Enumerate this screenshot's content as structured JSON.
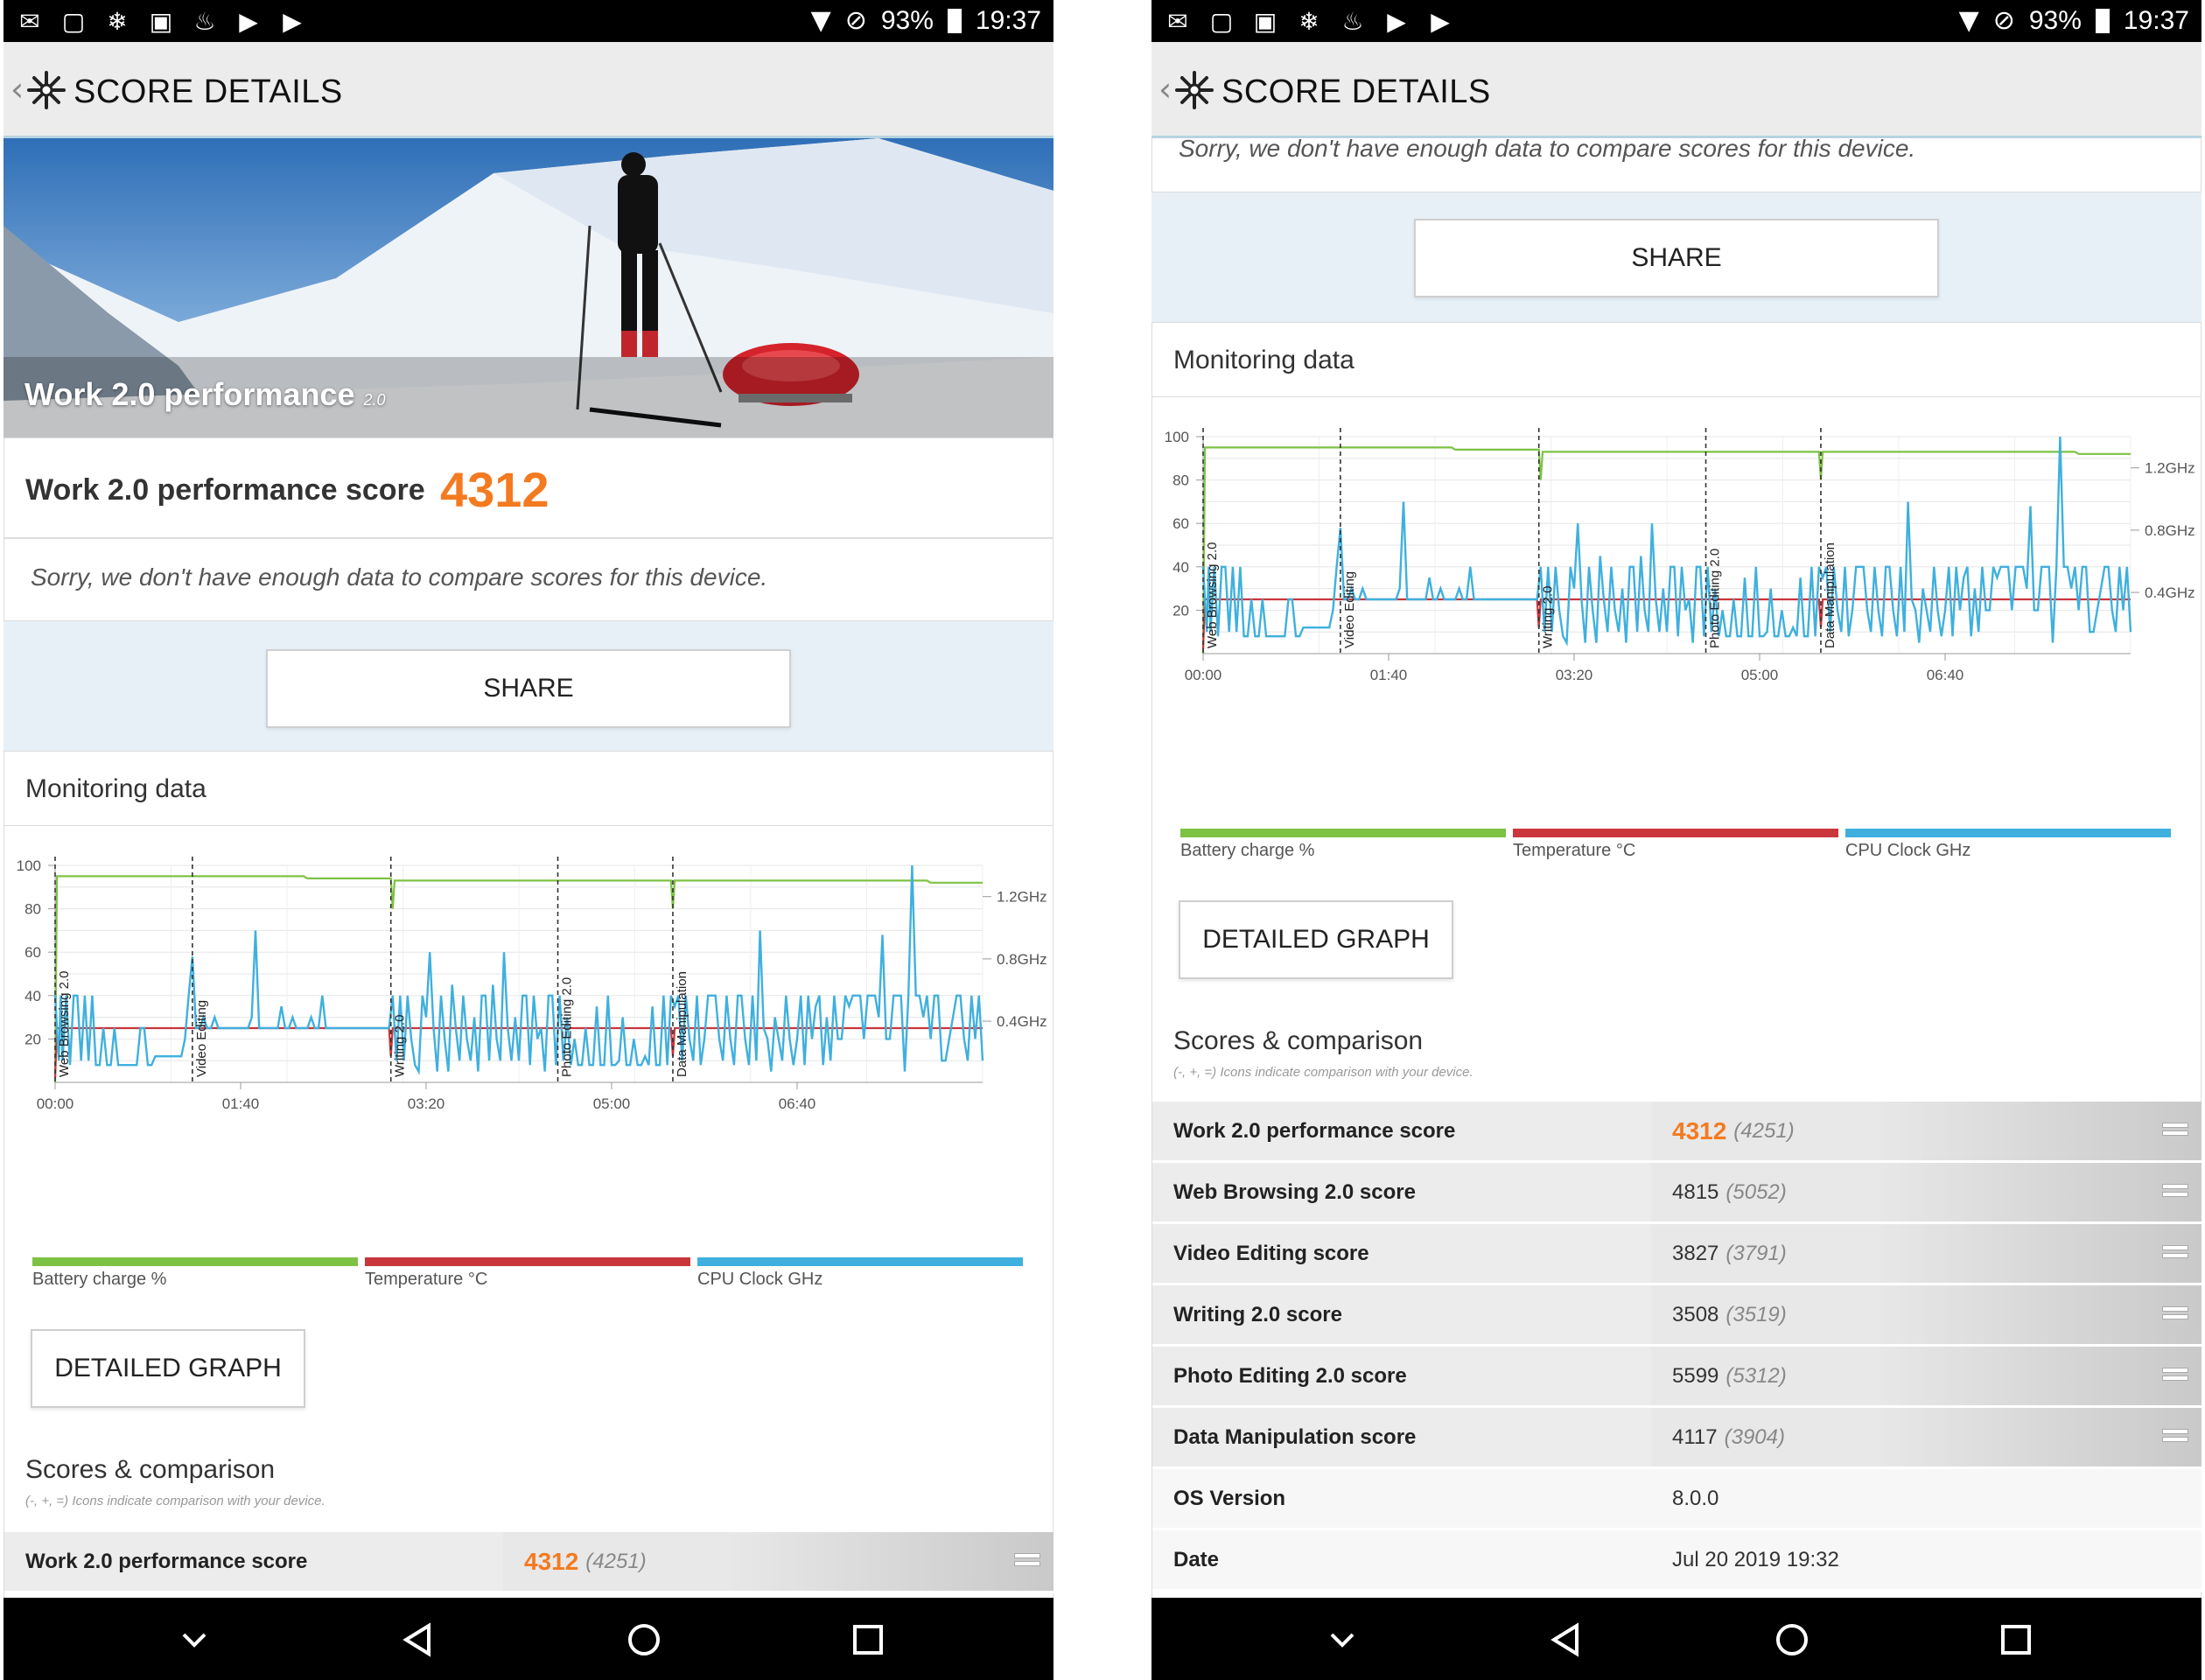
{
  "status_bar": {
    "battery": "93%",
    "time": "19:37"
  },
  "app": {
    "title": "SCORE DETAILS"
  },
  "hero": {
    "title": "Work 2.0 performance",
    "version": "2.0"
  },
  "score": {
    "label": "Work 2.0 performance score",
    "value": "4312"
  },
  "compare_message": "Sorry, we don't have enough data to compare scores for this device.",
  "share_label": "SHARE",
  "monitoring": {
    "title": "Monitoring data",
    "detailed_graph_label": "DETAILED GRAPH"
  },
  "chart_data": {
    "type": "line",
    "x_ticks": [
      "00:00",
      "01:40",
      "03:20",
      "05:00",
      "06:40"
    ],
    "y_left_ticks": [
      "100",
      "80",
      "60",
      "40",
      "20"
    ],
    "y_right_ticks": [
      "1.2GHz",
      "0.8GHz",
      "0.4GHz"
    ],
    "xlim_seconds": [
      0,
      500
    ],
    "ylim_left": [
      0,
      100
    ],
    "test_markers": [
      {
        "label": "Web Browsing 2.0",
        "t": 0
      },
      {
        "label": "Video Editing",
        "t": 74
      },
      {
        "label": "Writing 2.0",
        "t": 181
      },
      {
        "label": "Photo Editing 2.0",
        "t": 271
      },
      {
        "label": "Data Manipulation",
        "t": 333
      }
    ],
    "series": [
      {
        "name": "Battery charge %",
        "color": "#7dc243",
        "points": [
          [
            0,
            0
          ],
          [
            1,
            95
          ],
          [
            134,
            95
          ],
          [
            136,
            94
          ],
          [
            181,
            94
          ],
          [
            182,
            80
          ],
          [
            183,
            93
          ],
          [
            332,
            93
          ],
          [
            333,
            80
          ],
          [
            334,
            93
          ],
          [
            470,
            93
          ],
          [
            472,
            92
          ],
          [
            500,
            92
          ]
        ]
      },
      {
        "name": "Temperature °C",
        "color": "#c9363b",
        "points": [
          [
            0,
            2
          ],
          [
            1,
            25
          ],
          [
            180,
            25
          ],
          [
            181,
            12
          ],
          [
            182,
            25
          ],
          [
            332,
            25
          ],
          [
            333,
            12
          ],
          [
            334,
            25
          ],
          [
            500,
            25
          ]
        ]
      },
      {
        "name": "CPU Clock GHz",
        "color": "#3fb0de",
        "points": [
          [
            0,
            40
          ],
          [
            2,
            10
          ],
          [
            3,
            40
          ],
          [
            4,
            10
          ],
          [
            6,
            40
          ],
          [
            8,
            8
          ],
          [
            10,
            40
          ],
          [
            12,
            40
          ],
          [
            14,
            10
          ],
          [
            16,
            40
          ],
          [
            18,
            10
          ],
          [
            20,
            40
          ],
          [
            22,
            8
          ],
          [
            24,
            8
          ],
          [
            26,
            25
          ],
          [
            28,
            8
          ],
          [
            30,
            8
          ],
          [
            32,
            25
          ],
          [
            34,
            8
          ],
          [
            36,
            8
          ],
          [
            38,
            8
          ],
          [
            40,
            8
          ],
          [
            42,
            8
          ],
          [
            44,
            8
          ],
          [
            46,
            25
          ],
          [
            48,
            25
          ],
          [
            50,
            8
          ],
          [
            52,
            8
          ],
          [
            54,
            12
          ],
          [
            56,
            12
          ],
          [
            58,
            12
          ],
          [
            60,
            12
          ],
          [
            62,
            12
          ],
          [
            64,
            12
          ],
          [
            66,
            12
          ],
          [
            68,
            12
          ],
          [
            70,
            20
          ],
          [
            72,
            40
          ],
          [
            74,
            58
          ],
          [
            76,
            25
          ],
          [
            78,
            25
          ],
          [
            80,
            30
          ],
          [
            82,
            25
          ],
          [
            84,
            25
          ],
          [
            86,
            30
          ],
          [
            88,
            25
          ],
          [
            90,
            25
          ],
          [
            92,
            25
          ],
          [
            94,
            25
          ],
          [
            96,
            25
          ],
          [
            98,
            25
          ],
          [
            100,
            25
          ],
          [
            104,
            25
          ],
          [
            106,
            30
          ],
          [
            108,
            70
          ],
          [
            110,
            25
          ],
          [
            112,
            25
          ],
          [
            114,
            25
          ],
          [
            116,
            25
          ],
          [
            118,
            25
          ],
          [
            120,
            25
          ],
          [
            122,
            35
          ],
          [
            124,
            25
          ],
          [
            126,
            25
          ],
          [
            128,
            30
          ],
          [
            130,
            25
          ],
          [
            132,
            25
          ],
          [
            134,
            25
          ],
          [
            136,
            25
          ],
          [
            138,
            30
          ],
          [
            140,
            25
          ],
          [
            142,
            25
          ],
          [
            144,
            40
          ],
          [
            146,
            25
          ],
          [
            148,
            25
          ],
          [
            150,
            25
          ],
          [
            152,
            25
          ],
          [
            154,
            25
          ],
          [
            156,
            25
          ],
          [
            160,
            25
          ],
          [
            162,
            25
          ],
          [
            164,
            25
          ],
          [
            166,
            25
          ],
          [
            168,
            25
          ],
          [
            170,
            25
          ],
          [
            172,
            25
          ],
          [
            174,
            25
          ],
          [
            176,
            25
          ],
          [
            178,
            25
          ],
          [
            180,
            25
          ],
          [
            182,
            40
          ],
          [
            184,
            10
          ],
          [
            186,
            40
          ],
          [
            188,
            10
          ],
          [
            190,
            40
          ],
          [
            192,
            20
          ],
          [
            194,
            8
          ],
          [
            196,
            5
          ],
          [
            198,
            40
          ],
          [
            200,
            30
          ],
          [
            202,
            60
          ],
          [
            204,
            25
          ],
          [
            206,
            5
          ],
          [
            208,
            40
          ],
          [
            210,
            20
          ],
          [
            212,
            5
          ],
          [
            214,
            45
          ],
          [
            216,
            25
          ],
          [
            218,
            10
          ],
          [
            220,
            40
          ],
          [
            222,
            20
          ],
          [
            224,
            10
          ],
          [
            226,
            30
          ],
          [
            228,
            5
          ],
          [
            230,
            40
          ],
          [
            232,
            40
          ],
          [
            234,
            10
          ],
          [
            236,
            45
          ],
          [
            238,
            20
          ],
          [
            240,
            10
          ],
          [
            242,
            60
          ],
          [
            244,
            25
          ],
          [
            246,
            10
          ],
          [
            248,
            30
          ],
          [
            250,
            10
          ],
          [
            252,
            40
          ],
          [
            254,
            40
          ],
          [
            256,
            8
          ],
          [
            258,
            40
          ],
          [
            260,
            20
          ],
          [
            262,
            25
          ],
          [
            264,
            5
          ],
          [
            266,
            40
          ],
          [
            268,
            40
          ],
          [
            270,
            8
          ],
          [
            272,
            40
          ],
          [
            274,
            10
          ],
          [
            276,
            30
          ],
          [
            278,
            8
          ],
          [
            280,
            20
          ],
          [
            282,
            8
          ],
          [
            284,
            8
          ],
          [
            286,
            25
          ],
          [
            288,
            8
          ],
          [
            290,
            8
          ],
          [
            292,
            35
          ],
          [
            294,
            8
          ],
          [
            296,
            8
          ],
          [
            298,
            40
          ],
          [
            300,
            8
          ],
          [
            302,
            8
          ],
          [
            304,
            10
          ],
          [
            306,
            30
          ],
          [
            308,
            8
          ],
          [
            310,
            8
          ],
          [
            312,
            20
          ],
          [
            314,
            8
          ],
          [
            316,
            8
          ],
          [
            318,
            12
          ],
          [
            320,
            8
          ],
          [
            322,
            35
          ],
          [
            324,
            8
          ],
          [
            326,
            8
          ],
          [
            328,
            40
          ],
          [
            330,
            8
          ],
          [
            332,
            40
          ],
          [
            334,
            35
          ],
          [
            336,
            40
          ],
          [
            338,
            10
          ],
          [
            340,
            40
          ],
          [
            342,
            20
          ],
          [
            344,
            10
          ],
          [
            346,
            40
          ],
          [
            348,
            8
          ],
          [
            350,
            20
          ],
          [
            352,
            40
          ],
          [
            354,
            40
          ],
          [
            356,
            40
          ],
          [
            358,
            20
          ],
          [
            360,
            10
          ],
          [
            362,
            40
          ],
          [
            364,
            20
          ],
          [
            366,
            8
          ],
          [
            368,
            40
          ],
          [
            370,
            40
          ],
          [
            372,
            20
          ],
          [
            374,
            8
          ],
          [
            376,
            40
          ],
          [
            378,
            10
          ],
          [
            380,
            70
          ],
          [
            382,
            25
          ],
          [
            384,
            20
          ],
          [
            386,
            5
          ],
          [
            388,
            30
          ],
          [
            390,
            20
          ],
          [
            392,
            10
          ],
          [
            394,
            40
          ],
          [
            396,
            20
          ],
          [
            398,
            8
          ],
          [
            400,
            20
          ],
          [
            402,
            40
          ],
          [
            404,
            8
          ],
          [
            406,
            40
          ],
          [
            408,
            20
          ],
          [
            410,
            35
          ],
          [
            412,
            40
          ],
          [
            414,
            8
          ],
          [
            416,
            30
          ],
          [
            418,
            10
          ],
          [
            420,
            40
          ],
          [
            422,
            20
          ],
          [
            424,
            20
          ],
          [
            426,
            40
          ],
          [
            428,
            35
          ],
          [
            430,
            40
          ],
          [
            432,
            40
          ],
          [
            434,
            40
          ],
          [
            436,
            20
          ],
          [
            438,
            40
          ],
          [
            440,
            40
          ],
          [
            442,
            40
          ],
          [
            444,
            30
          ],
          [
            446,
            68
          ],
          [
            448,
            20
          ],
          [
            450,
            20
          ],
          [
            452,
            40
          ],
          [
            454,
            40
          ],
          [
            456,
            40
          ],
          [
            458,
            5
          ],
          [
            460,
            40
          ],
          [
            462,
            100
          ],
          [
            464,
            40
          ],
          [
            466,
            40
          ],
          [
            468,
            30
          ],
          [
            470,
            40
          ],
          [
            472,
            20
          ],
          [
            474,
            40
          ],
          [
            476,
            40
          ],
          [
            478,
            10
          ],
          [
            480,
            10
          ],
          [
            482,
            20
          ],
          [
            484,
            30
          ],
          [
            486,
            40
          ],
          [
            488,
            40
          ],
          [
            490,
            20
          ],
          [
            492,
            10
          ],
          [
            494,
            40
          ],
          [
            496,
            20
          ],
          [
            498,
            40
          ],
          [
            500,
            10
          ]
        ]
      }
    ]
  },
  "scores": {
    "title": "Scores & comparison",
    "subtitle": "(-, +, =) Icons indicate comparison with your device.",
    "rows": [
      {
        "label": "Work 2.0 performance score",
        "value": "4312",
        "compare": "(4251)",
        "icon": "equals-icon",
        "highlight": true
      },
      {
        "label": "Web Browsing 2.0 score",
        "value": "4815",
        "compare": "(5052)",
        "icon": "equals-icon",
        "highlight": false
      },
      {
        "label": "Video Editing score",
        "value": "3827",
        "compare": "(3791)",
        "icon": "equals-icon",
        "highlight": false
      },
      {
        "label": "Writing 2.0 score",
        "value": "3508",
        "compare": "(3519)",
        "icon": "equals-icon",
        "highlight": false
      },
      {
        "label": "Photo Editing 2.0 score",
        "value": "5599",
        "compare": "(5312)",
        "icon": "equals-icon",
        "highlight": false
      },
      {
        "label": "Data Manipulation score",
        "value": "4117",
        "compare": "(3904)",
        "icon": "equals-icon",
        "highlight": false
      },
      {
        "label": "OS Version",
        "value": "8.0.0",
        "compare": "",
        "icon": "",
        "highlight": false
      },
      {
        "label": "Date",
        "value": "Jul 20 2019 19:32",
        "compare": "",
        "icon": "",
        "highlight": false
      }
    ]
  },
  "colors": {
    "accent_orange": "#f47a20",
    "battery": "#7dc243",
    "temperature": "#c9363b",
    "cpu": "#3fb0de"
  }
}
